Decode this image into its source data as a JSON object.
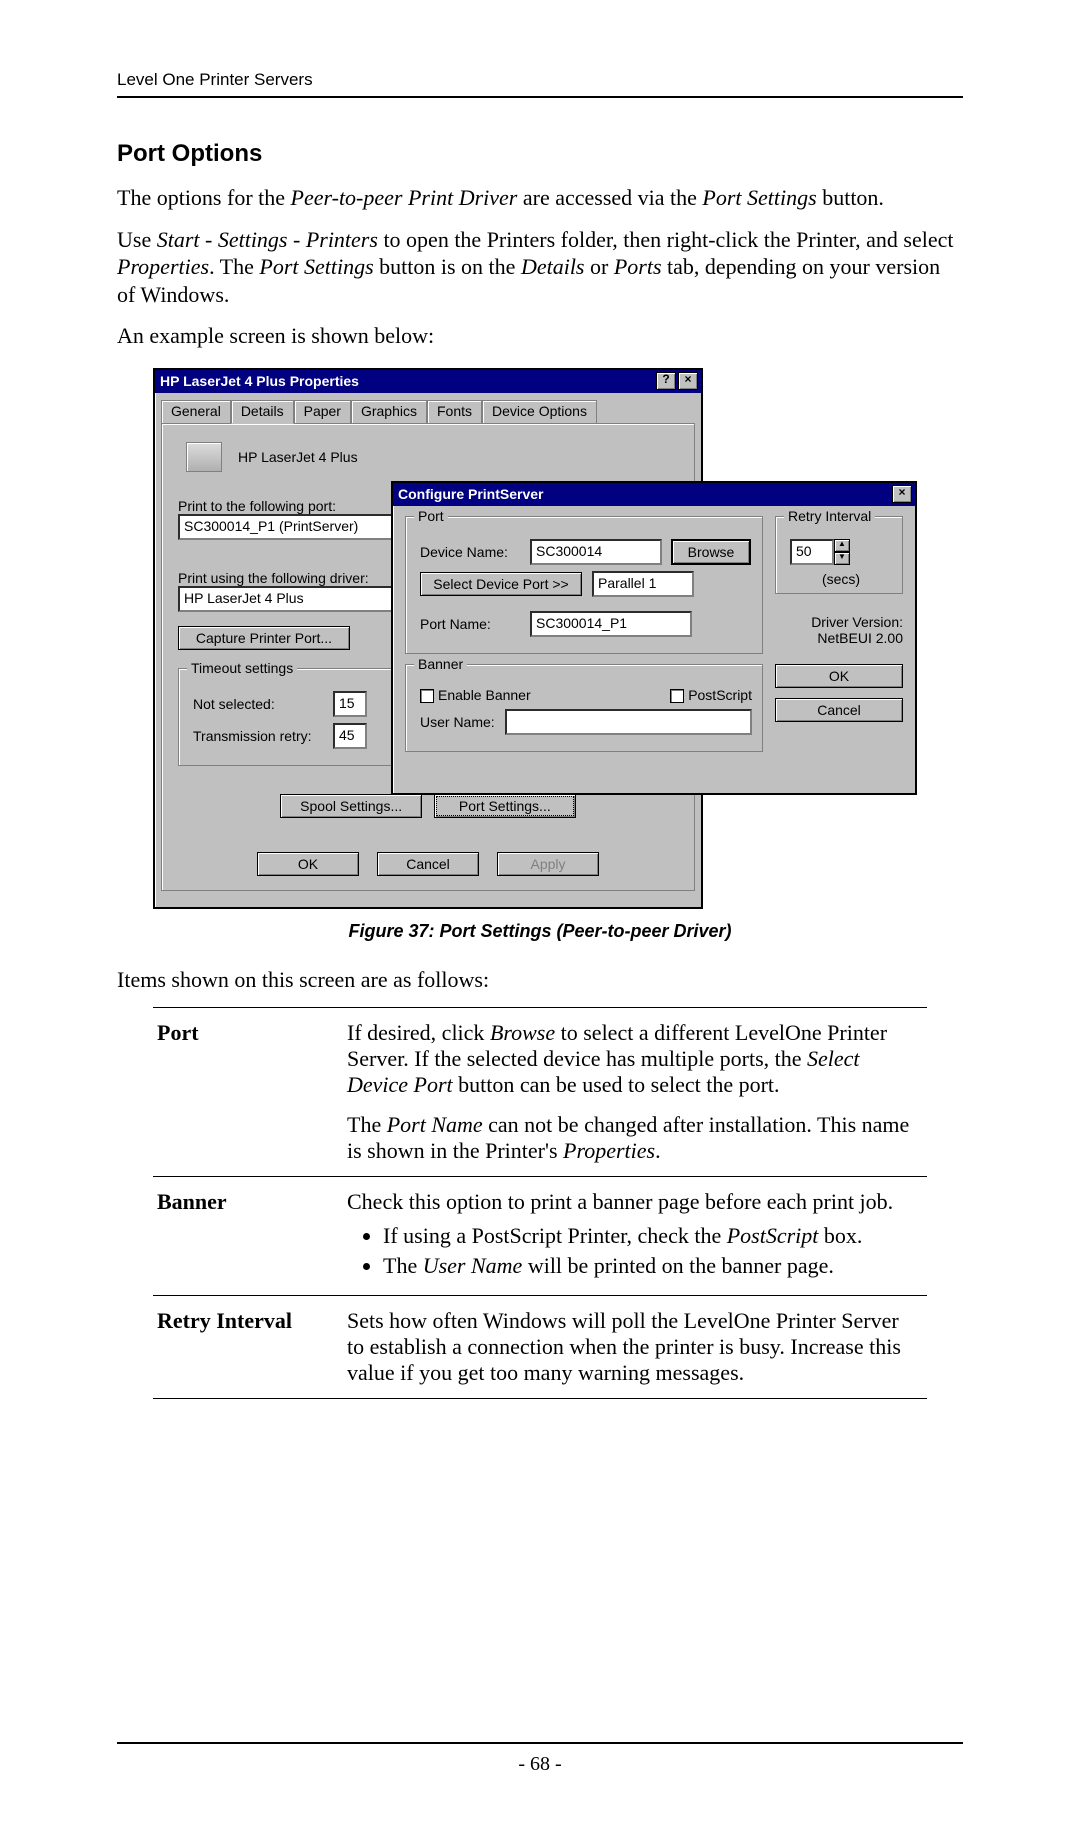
{
  "running_head": "Level One Printer Servers",
  "heading": "Port Options",
  "para1_a": "The options for the ",
  "para1_i1": "Peer-to-peer Print Driver",
  "para1_b": " are accessed via the ",
  "para1_i2": "Port Settings",
  "para1_c": " button.",
  "para2_a": "Use ",
  "para2_i1": "Start - Settings - Printers",
  "para2_b": " to open the Printers folder, then right-click the Printer, and select ",
  "para2_i2": "Properties",
  "para2_c": ". The ",
  "para2_i3": "Port Settings",
  "para2_d": " button is on the ",
  "para2_i4": "Details",
  "para2_e": " or ",
  "para2_i5": "Ports",
  "para2_f": " tab, depending on your version of Windows.",
  "para3": "An example screen is shown below:",
  "dlg1": {
    "title": "HP LaserJet 4 Plus Properties",
    "tabs": [
      "General",
      "Details",
      "Paper",
      "Graphics",
      "Fonts",
      "Device Options"
    ],
    "printer_name": "HP LaserJet 4 Plus",
    "print_port_label": "Print to the following port:",
    "print_port_value": "SC300014_P1  (PrintServer)",
    "driver_label": "Print using the following driver:",
    "driver_value": "HP LaserJet 4 Plus",
    "capture_btn": "Capture Printer Port...",
    "timeout_title": "Timeout settings",
    "not_selected_label": "Not selected:",
    "not_selected_value": "15",
    "retry_label": "Transmission retry:",
    "retry_value": "45",
    "spool_btn": "Spool Settings...",
    "port_btn": "Port Settings...",
    "ok": "OK",
    "cancel": "Cancel",
    "apply": "Apply"
  },
  "dlg2": {
    "title": "Configure PrintServer",
    "port_group": "Port",
    "device_name_label": "Device Name:",
    "device_name_value": "SC300014",
    "browse": "Browse",
    "select_port_btn": "Select Device Port >>",
    "select_port_value": "Parallel 1",
    "port_name_label": "Port Name:",
    "port_name_value": "SC300014_P1",
    "banner_group": "Banner",
    "enable_banner": "Enable Banner",
    "postscript": "PostScript",
    "user_name_label": "User Name:",
    "retry_group": "Retry Interval",
    "retry_value": "50",
    "secs": "(secs)",
    "driver_version_label": "Driver Version:",
    "driver_version_value": "NetBEUI   2.00",
    "ok": "OK",
    "cancel": "Cancel"
  },
  "caption": "Figure 37: Port Settings (Peer-to-peer Driver)",
  "para4": "Items shown on this screen are as follows:",
  "tbl": {
    "port_k": "Port",
    "port_v1a": "If desired, click ",
    "port_v1i1": "Browse",
    "port_v1b": " to select a different LevelOne Printer Server. If the selected device has multiple ports, the ",
    "port_v1i2": "Select Device Port",
    "port_v1c": " button can be used to select the port.",
    "port_v2a": "The ",
    "port_v2i1": "Port Name",
    "port_v2b": " can not be changed after installation. This name is shown in the Printer's ",
    "port_v2i2": "Properties",
    "port_v2c": ".",
    "banner_k": "Banner",
    "banner_v": "Check this option to print a banner page before each print job.",
    "banner_li1a": "If using a PostScript Printer, check the ",
    "banner_li1i": "PostScript",
    "banner_li1b": " box.",
    "banner_li2a": "The ",
    "banner_li2i": "User Name",
    "banner_li2b": " will be printed on the banner page.",
    "retry_k": "Retry Interval",
    "retry_v": "Sets how often Windows will poll the LevelOne Printer Server to establish a connection when the printer is busy. Increase this value if you get too many warning messages."
  },
  "pagenum": "- 68 -"
}
